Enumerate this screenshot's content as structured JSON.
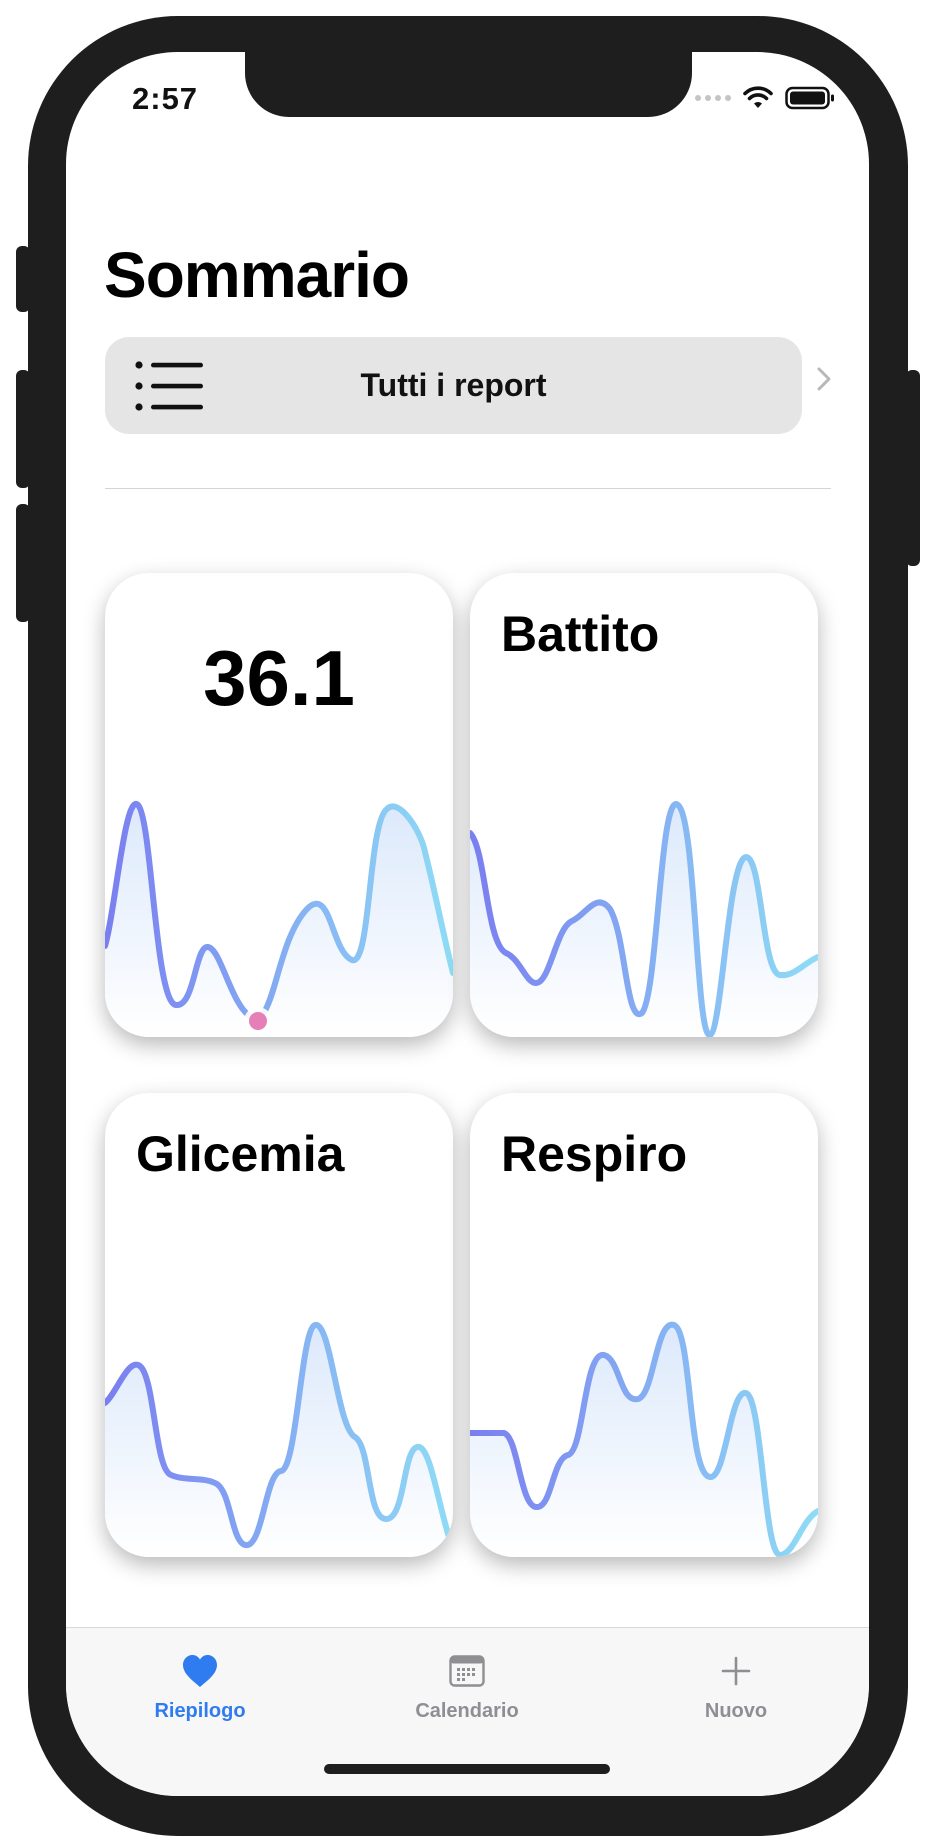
{
  "status_bar": {
    "time": "2:57"
  },
  "page": {
    "title": "Sommario"
  },
  "reports_button": {
    "label": "Tutti i report",
    "icon": "list-icon"
  },
  "cards": [
    {
      "id": "temperature",
      "value": "36.1",
      "title": ""
    },
    {
      "id": "battito",
      "value": "",
      "title": "Battito"
    },
    {
      "id": "glicemia",
      "value": "",
      "title": "Glicemia"
    },
    {
      "id": "respiro",
      "value": "",
      "title": "Respiro"
    }
  ],
  "tab_bar": {
    "items": [
      {
        "label": "Riepilogo",
        "icon": "heart-icon",
        "active": true
      },
      {
        "label": "Calendario",
        "icon": "calendar-icon",
        "active": false
      },
      {
        "label": "Nuovo",
        "icon": "plus-icon",
        "active": false
      }
    ]
  },
  "colors": {
    "accent": "#2f7cf0",
    "tab_inactive": "#8e8e93",
    "wave_start": "#7a7ef0",
    "wave_end": "#8fdcf5",
    "marker": "#e57fb6",
    "fill_top": "#dce9fb"
  }
}
